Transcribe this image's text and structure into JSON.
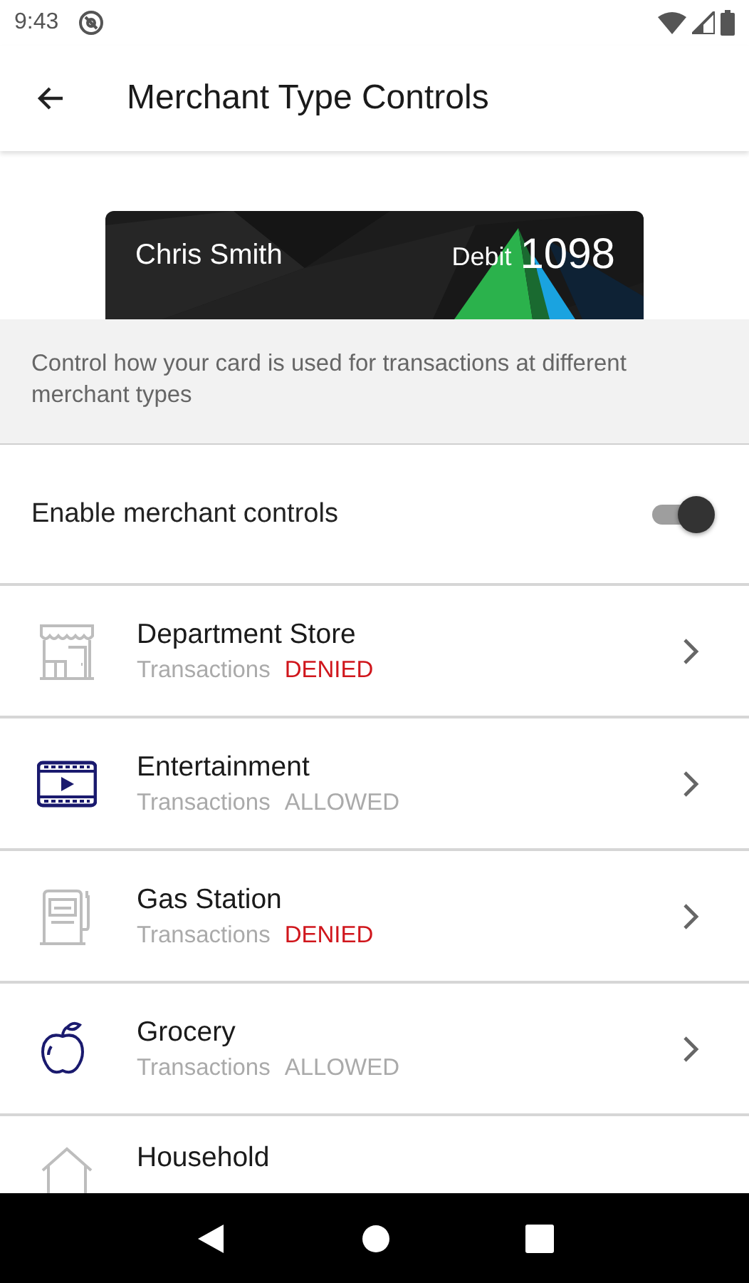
{
  "status_bar": {
    "time": "9:43"
  },
  "app_bar": {
    "title": "Merchant Type Controls"
  },
  "card": {
    "holder": "Chris Smith",
    "type": "Debit",
    "number": "1098"
  },
  "description": "Control how your card is used for transactions at different merchant types",
  "merchant_controls": {
    "label": "Enable merchant controls",
    "on": true
  },
  "merchants": [
    {
      "kind": "store",
      "name": "Department Store",
      "label": "Transactions",
      "status": "DENIED",
      "allowed": false
    },
    {
      "kind": "film",
      "name": "Entertainment",
      "label": "Transactions",
      "status": "ALLOWED",
      "allowed": true
    },
    {
      "kind": "fuel",
      "name": "Gas Station",
      "label": "Transactions",
      "status": "DENIED",
      "allowed": false
    },
    {
      "kind": "apple",
      "name": "Grocery",
      "label": "Transactions",
      "status": "ALLOWED",
      "allowed": true
    },
    {
      "kind": "house",
      "name": "Household"
    }
  ]
}
